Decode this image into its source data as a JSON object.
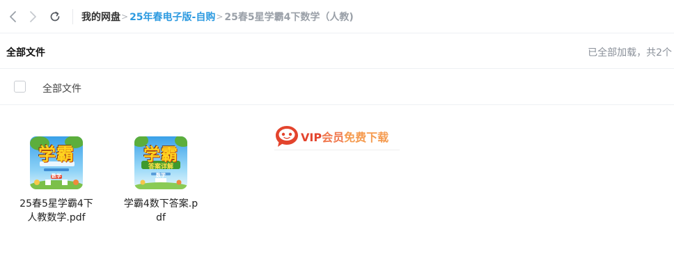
{
  "nav": {
    "back_icon": "chevron-left-icon",
    "forward_icon": "chevron-right-icon",
    "refresh_icon": "refresh-icon"
  },
  "breadcrumb": {
    "root": "我的网盘",
    "folder": "25年春电子版-自购",
    "current": "25春5星学霸4下数学（人教)",
    "separator": ">"
  },
  "files_header": {
    "title": "全部文件",
    "status": "已全部加载，共2个"
  },
  "select_all": {
    "label": "全部文件",
    "checked": false
  },
  "vip_banner": {
    "part1": "VIP",
    "part2": "会员",
    "part3": "免费下载",
    "icon": "chat-bubble-icon"
  },
  "files": [
    {
      "name": "25春5星学霸4下人教数学.pdf",
      "cover_title": "学霸",
      "cover_tag": "数学"
    },
    {
      "name": "学霸4数下答案.pdf",
      "cover_title": "学霸",
      "cover_subtitle": "答案详解",
      "cover_tag": "数学"
    }
  ],
  "colors": {
    "link": "#2c9ae0",
    "muted": "#9aa0a8",
    "vip_red": "#e3442d",
    "vip_orange": "#f0774c"
  }
}
